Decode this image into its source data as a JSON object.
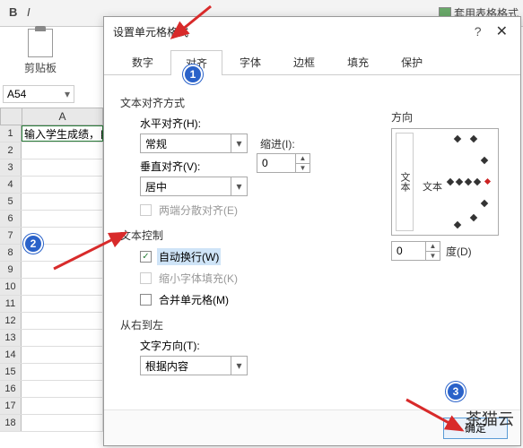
{
  "ribbon": {
    "tablefmt": "套用表格格式"
  },
  "clipboard": {
    "label": "剪贴板"
  },
  "cellref": {
    "value": "A54"
  },
  "column": "A",
  "cell_a1": "输入学生成绩，自动",
  "dialog": {
    "title": "设置单元格格式",
    "tabs": [
      "数字",
      "对齐",
      "字体",
      "边框",
      "填充",
      "保护"
    ],
    "active_tab": 1,
    "section_textalign": "文本对齐方式",
    "halign_label": "水平对齐(H):",
    "halign_value": "常规",
    "indent_label": "缩进(I):",
    "indent_value": "0",
    "valign_label": "垂直对齐(V):",
    "valign_value": "居中",
    "justify_distributed": "两端分散对齐(E)",
    "section_textcontrol": "文本控制",
    "wrap_text": "自动换行(W)",
    "shrink_fit": "缩小字体填充(K)",
    "merge_cells": "合并单元格(M)",
    "section_rtl": "从右到左",
    "textdir_label": "文字方向(T):",
    "textdir_value": "根据内容",
    "direction_title": "方向",
    "direction_vertical": "文本",
    "direction_center": "文本",
    "degree_value": "0",
    "degree_label": "度(D)",
    "ok": "确定"
  },
  "callouts": {
    "c1": "1",
    "c2": "2",
    "c3": "3"
  },
  "watermark": "茶猫云"
}
